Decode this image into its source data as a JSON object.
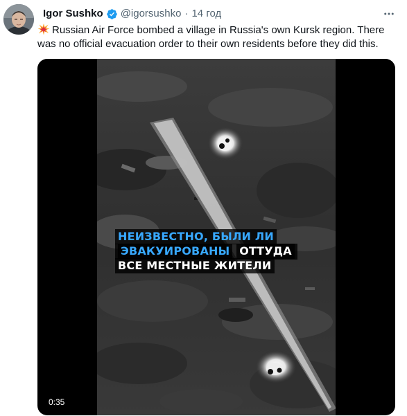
{
  "tweet": {
    "author": {
      "name": "Igor Sushko",
      "handle": "@igorsushko",
      "verified": true,
      "avatar": "profile-photo"
    },
    "time": "14 год",
    "dot": "·",
    "emoji": "collision-icon",
    "text": "Russian Air Force bombed a village in Russia's own Kursk region. There was no official evacuation order to their own residents before they did this.",
    "more_icon": "more-horizontal-icon"
  },
  "video": {
    "caption": {
      "line1": "НЕИЗВЕСТНО, БЫЛИ ЛИ",
      "line2_highlight": "ЭВАКУИРОВАНЫ",
      "line2_rest": "ОТТУДА",
      "line3": "ВСЕ МЕСТНЫЕ ЖИТЕЛИ"
    },
    "duration": "0:35"
  },
  "colors": {
    "accent": "#1d9bf0",
    "caption_blue": "#38a8ff",
    "text": "#0f1419",
    "secondary_text": "#536471"
  }
}
